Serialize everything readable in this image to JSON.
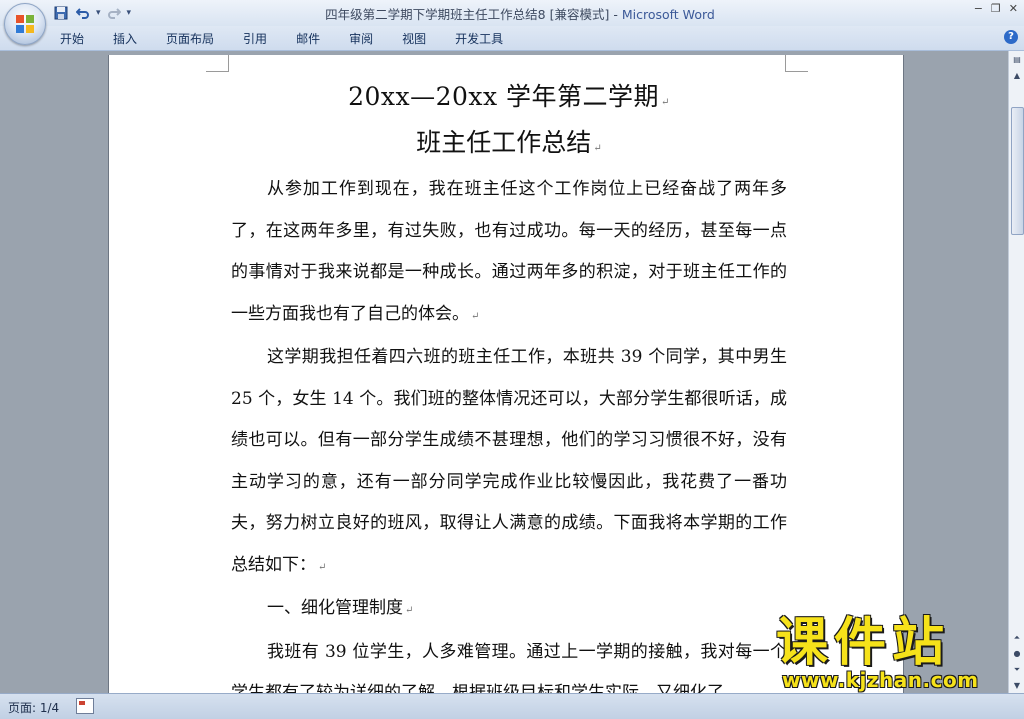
{
  "window": {
    "doc_title": "四年级第二学期下学期班主任工作总结8 [兼容模式]",
    "separator": " - ",
    "app_name": "Microsoft Word",
    "controls": {
      "minimize": "−",
      "restore": "❐",
      "close": "✕"
    }
  },
  "quick_access": {
    "save_icon": "save-icon",
    "undo_icon": "undo-icon",
    "redo_icon": "redo-icon",
    "customize": "▾"
  },
  "ribbon": {
    "tabs": [
      "开始",
      "插入",
      "页面布局",
      "引用",
      "邮件",
      "审阅",
      "视图",
      "开发工具"
    ],
    "help": "?"
  },
  "document": {
    "title_line1": "20xx—20xx 学年第二学期",
    "title_line2": "班主任工作总结",
    "paragraphs": [
      "从参加工作到现在，我在班主任这个工作岗位上已经奋战了两年多了，在这两年多里，有过失败，也有过成功。每一天的经历，甚至每一点的事情对于我来说都是一种成长。通过两年多的积淀，对于班主任工作的一些方面我也有了自己的体会。",
      "这学期我担任着四六班的班主任工作，本班共 39 个同学，其中男生 25 个，女生 14 个。我们班的整体情况还可以，大部分学生都很听话，成绩也可以。但有一部分学生成绩不甚理想，他们的学习习惯很不好，没有主动学习的意，还有一部分同学完成作业比较慢因此，我花费了一番功夫，努力树立良好的班风，取得让人满意的成绩。下面我将本学期的工作总结如下：",
      "一、细化管理制度",
      "我班有 39 位学生，人多难管理。通过上一学期的接触，我对每一个学生都有了较为详细的了解，根据班级目标和学生实际，又细化了"
    ],
    "para_mark": "↵"
  },
  "status": {
    "page": "页面: 1/4"
  },
  "watermark": {
    "text": "课件站",
    "url": "www.kjzhan.com"
  }
}
